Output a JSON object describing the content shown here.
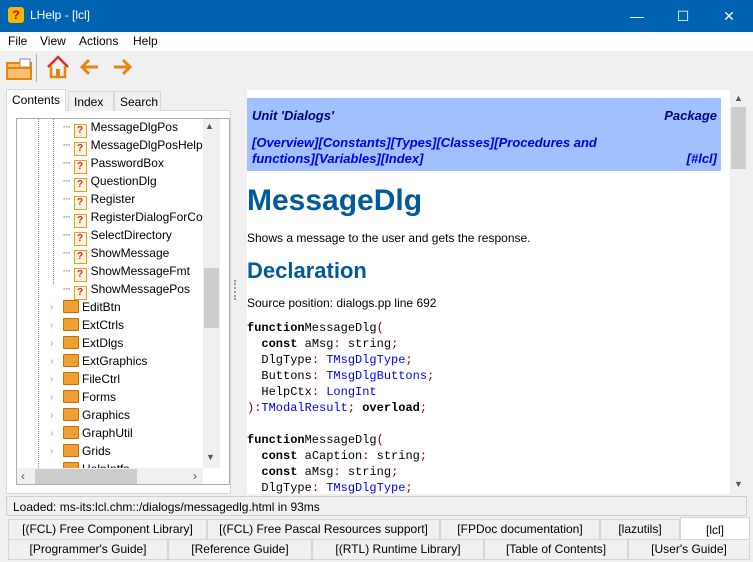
{
  "window": {
    "title": "LHelp -  [lcl]",
    "minimize": "—",
    "maximize": "☐",
    "close": "✕"
  },
  "menu": [
    {
      "label": "File"
    },
    {
      "label": "View"
    },
    {
      "label": "Actions"
    },
    {
      "label": "Help"
    }
  ],
  "toolbar": {
    "open_icon": "folder-open-icon",
    "home_icon": "home-icon",
    "back_icon": "arrow-left-icon",
    "forward_icon": "arrow-right-icon",
    "accent": "#e8850f"
  },
  "tabs": [
    {
      "label": "Contents",
      "active": true
    },
    {
      "label": "Index"
    },
    {
      "label": "Search"
    }
  ],
  "tree": {
    "pages": [
      "MessageDlgPos",
      "MessageDlgPosHelp",
      "PasswordBox",
      "QuestionDlg",
      "Register",
      "RegisterDialogForCo",
      "SelectDirectory",
      "ShowMessage",
      "ShowMessageFmt",
      "ShowMessagePos"
    ],
    "units": [
      "EditBtn",
      "ExtCtrls",
      "ExtDlgs",
      "ExtGraphics",
      "FileCtrl",
      "Forms",
      "Graphics",
      "GraphUtil",
      "Grids",
      "HelpIntfs"
    ]
  },
  "content": {
    "unit": "Unit 'Dialogs'",
    "package": "Package",
    "links": [
      "[Overview]",
      "[Constants]",
      "[Types]",
      "[Classes]",
      "[Procedures and",
      "functions]",
      "[Variables]",
      "[Index]"
    ],
    "package_link": "[#lcl]",
    "title": "MessageDlg",
    "description": "Shows a message to the user and gets the response.",
    "declaration_heading": "Declaration",
    "source": "Source position: dialogs.pp line 692",
    "code": [
      [
        [
          "kw",
          "function"
        ],
        [
          "",
          "MessageDlg"
        ],
        [
          "pn",
          "("
        ]
      ],
      [
        [
          "",
          "  "
        ],
        [
          "kw",
          "const"
        ],
        [
          "",
          " aMsg"
        ],
        [
          "pn",
          ":"
        ],
        [
          "",
          " string"
        ],
        [
          "pn",
          ";"
        ]
      ],
      [
        [
          "",
          "  DlgType"
        ],
        [
          "pn",
          ":"
        ],
        [
          "",
          " "
        ],
        [
          "ty",
          "TMsgDlgType"
        ],
        [
          "pn",
          ";"
        ]
      ],
      [
        [
          "",
          "  Buttons"
        ],
        [
          "pn",
          ":"
        ],
        [
          "",
          " "
        ],
        [
          "ty",
          "TMsgDlgButtons"
        ],
        [
          "pn",
          ";"
        ]
      ],
      [
        [
          "",
          "  HelpCtx"
        ],
        [
          "pn",
          ":"
        ],
        [
          "",
          " "
        ],
        [
          "ty",
          "LongInt"
        ]
      ],
      [
        [
          "pn",
          "):"
        ],
        [
          "ty",
          "TModalResult"
        ],
        [
          "pn",
          ";"
        ],
        [
          "",
          " "
        ],
        [
          "kw",
          "overload"
        ],
        [
          "pn",
          ";"
        ]
      ],
      [],
      [
        [
          "kw",
          "function"
        ],
        [
          "",
          "MessageDlg"
        ],
        [
          "pn",
          "("
        ]
      ],
      [
        [
          "",
          "  "
        ],
        [
          "kw",
          "const"
        ],
        [
          "",
          " aCaption"
        ],
        [
          "pn",
          ":"
        ],
        [
          "",
          " string"
        ],
        [
          "pn",
          ";"
        ]
      ],
      [
        [
          "",
          "  "
        ],
        [
          "kw",
          "const"
        ],
        [
          "",
          " aMsg"
        ],
        [
          "pn",
          ":"
        ],
        [
          "",
          " string"
        ],
        [
          "pn",
          ";"
        ]
      ],
      [
        [
          "",
          "  DlgType"
        ],
        [
          "pn",
          ":"
        ],
        [
          "",
          " "
        ],
        [
          "ty",
          "TMsgDlgType"
        ],
        [
          "pn",
          ";"
        ]
      ]
    ]
  },
  "status": "Loaded: ms-its:lcl.chm::/dialogs/messagedlg.html in 93ms",
  "bottom_tabs": {
    "row1": [
      "[(FCL) Free Component Library]",
      "[(FCL) Free Pascal Resources support]",
      "[FPDoc documentation]",
      "[lazutils]",
      "[lcl]"
    ],
    "row2": [
      "[Programmer's Guide]",
      "[Reference Guide]",
      "[(RTL) Runtime Library]",
      "[Table of Contents]",
      "[User's Guide]"
    ],
    "selected": "[lcl]"
  }
}
